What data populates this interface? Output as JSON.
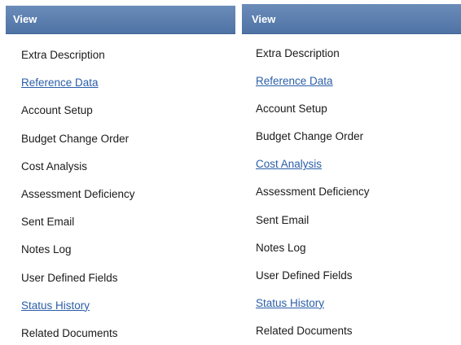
{
  "left_panel": {
    "header": "View",
    "items": [
      {
        "label": "Extra Description",
        "link": false
      },
      {
        "label": "Reference Data",
        "link": true
      },
      {
        "label": "Account Setup",
        "link": false
      },
      {
        "label": "Budget Change Order",
        "link": false
      },
      {
        "label": "Cost Analysis",
        "link": false
      },
      {
        "label": "Assessment Deficiency",
        "link": false
      },
      {
        "label": "Sent Email",
        "link": false
      },
      {
        "label": "Notes Log",
        "link": false
      },
      {
        "label": "User Defined Fields",
        "link": false
      },
      {
        "label": "Status History",
        "link": true
      },
      {
        "label": "Related Documents",
        "link": false
      }
    ]
  },
  "right_panel": {
    "header": "View",
    "items": [
      {
        "label": "Extra Description",
        "link": false
      },
      {
        "label": "Reference Data",
        "link": true
      },
      {
        "label": "Account Setup",
        "link": false
      },
      {
        "label": "Budget Change Order",
        "link": false
      },
      {
        "label": "Cost Analysis",
        "link": true
      },
      {
        "label": "Assessment Deficiency",
        "link": false
      },
      {
        "label": "Sent Email",
        "link": false
      },
      {
        "label": "Notes Log",
        "link": false
      },
      {
        "label": "User Defined Fields",
        "link": false
      },
      {
        "label": "Status History",
        "link": true
      },
      {
        "label": "Related Documents",
        "link": false
      }
    ]
  },
  "colors": {
    "header_bg": "#5a7fb0",
    "link": "#2b5ea8",
    "text": "#1a1a1a"
  }
}
